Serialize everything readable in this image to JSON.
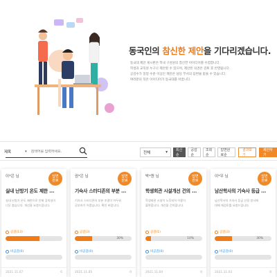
{
  "hero": {
    "title_prefix": "동국인의 ",
    "title_highlight": "참신한 제안",
    "title_suffix": "을 기다리겠습니다.",
    "desc_lines": [
      "동국대 제안 게시판은 학내 구성원의 참신한 아이디어를 수렴합니다.",
      "학생과 교직원 누구나 제안할 수 있으며, 제안된 의견은 검토 후 반영됩니다.",
      "공감수가 일정 수준 이상인 제안은 담당 부서의 답변을 받을 수 있습니다.",
      "여러분의 작은 아이디어가 동국대를 바꿉니다."
    ],
    "colors": {
      "accent": "#f07b16"
    }
  },
  "search": {
    "select_label": "제목",
    "placeholder": "검색어를 입력하세요."
  },
  "filters": {
    "sort_label": "전체",
    "buttons": [
      "최신순",
      "공감순",
      "조회순",
      "답변완료순"
    ],
    "write_label": "결과보기",
    "propose_label": "제안하기"
  },
  "cards": [
    {
      "author": "이*은 님",
      "badge": [
        "답변",
        "완료"
      ],
      "title": "실내 난방기 온도 제한 ...",
      "desc": [
        "실내 난방기 온도 제한으로 인해 강의실이",
        "너무 춥습니다. 개선을 요청드립니다."
      ],
      "stat1": "공감(13)",
      "progress1": 0.6,
      "pct1": "",
      "stat2": "비공감(0)",
      "progress2": 0,
      "pct2": "",
      "date": "2021.11.07",
      "count": "0"
    },
    {
      "author": "권*은 님",
      "badge": [
        "답변",
        "완료"
      ],
      "title": "기숙사 스터디존의 부분 ...",
      "desc": [
        "기숙사 스터디존의 부분 조명이 어두워",
        "공부하기 어렵습니다. 확인 바랍니다."
      ],
      "stat1": "공감(3)",
      "progress1": 0.3,
      "pct1": "30%",
      "stat2": "비공감(0)",
      "progress2": 0,
      "pct2": "",
      "date": "2021.11.05",
      "count": "0"
    },
    {
      "author": "박*원 님",
      "badge": [
        "답변",
        "완료"
      ],
      "title": "학생회관 시설개선 건의 ...",
      "desc": [
        "학생회관 시설이 노후되어 이용이",
        "불편합니다. 개선을 건의합니다."
      ],
      "stat1": "공감(1)",
      "progress1": 0.1,
      "pct1": "10%",
      "stat2": "비공감(0)",
      "progress2": 0,
      "pct2": "",
      "date": "2021.11.04",
      "count": "0"
    },
    {
      "author": "이*우 님",
      "badge": [
        "답변",
        "완료"
      ],
      "title": "남산학사의 기숙사 등급 ...",
      "desc": [
        "남산학사의 기숙사 등급 산정 방식에",
        "대해 재검토를 요청드립니다."
      ],
      "stat1": "공감(3)",
      "progress1": 0.3,
      "pct1": "30%",
      "stat2": "비공감(0)",
      "progress2": 0,
      "pct2": "",
      "date": "2021.11.02",
      "count": "0"
    }
  ]
}
